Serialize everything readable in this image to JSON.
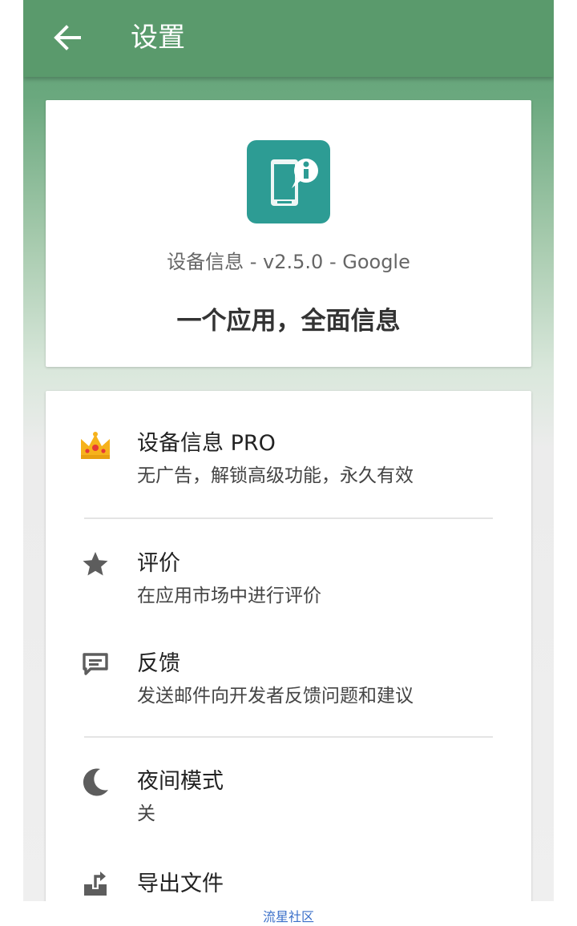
{
  "toolbar": {
    "title": "设置",
    "back_icon": "arrow-left-icon",
    "background": "#5a9a6c"
  },
  "about": {
    "app_icon": "phone-info-icon",
    "icon_color": "#2d9c94",
    "version_line": "设备信息 - v2.5.0 - Google",
    "slogan": "一个应用，全面信息"
  },
  "settings": {
    "items": [
      {
        "icon": "crown-icon",
        "title": "设备信息 PRO",
        "subtitle": "无广告，解锁高级功能，永久有效"
      },
      {
        "icon": "star-icon",
        "title": "评价",
        "subtitle": "在应用市场中进行评价"
      },
      {
        "icon": "feedback-icon",
        "title": "反馈",
        "subtitle": "发送邮件向开发者反馈问题和建议"
      },
      {
        "icon": "moon-icon",
        "title": "夜间模式",
        "subtitle": "关"
      },
      {
        "icon": "export-icon",
        "title": "导出文件",
        "subtitle": ""
      }
    ]
  },
  "watermark": "流星社区"
}
